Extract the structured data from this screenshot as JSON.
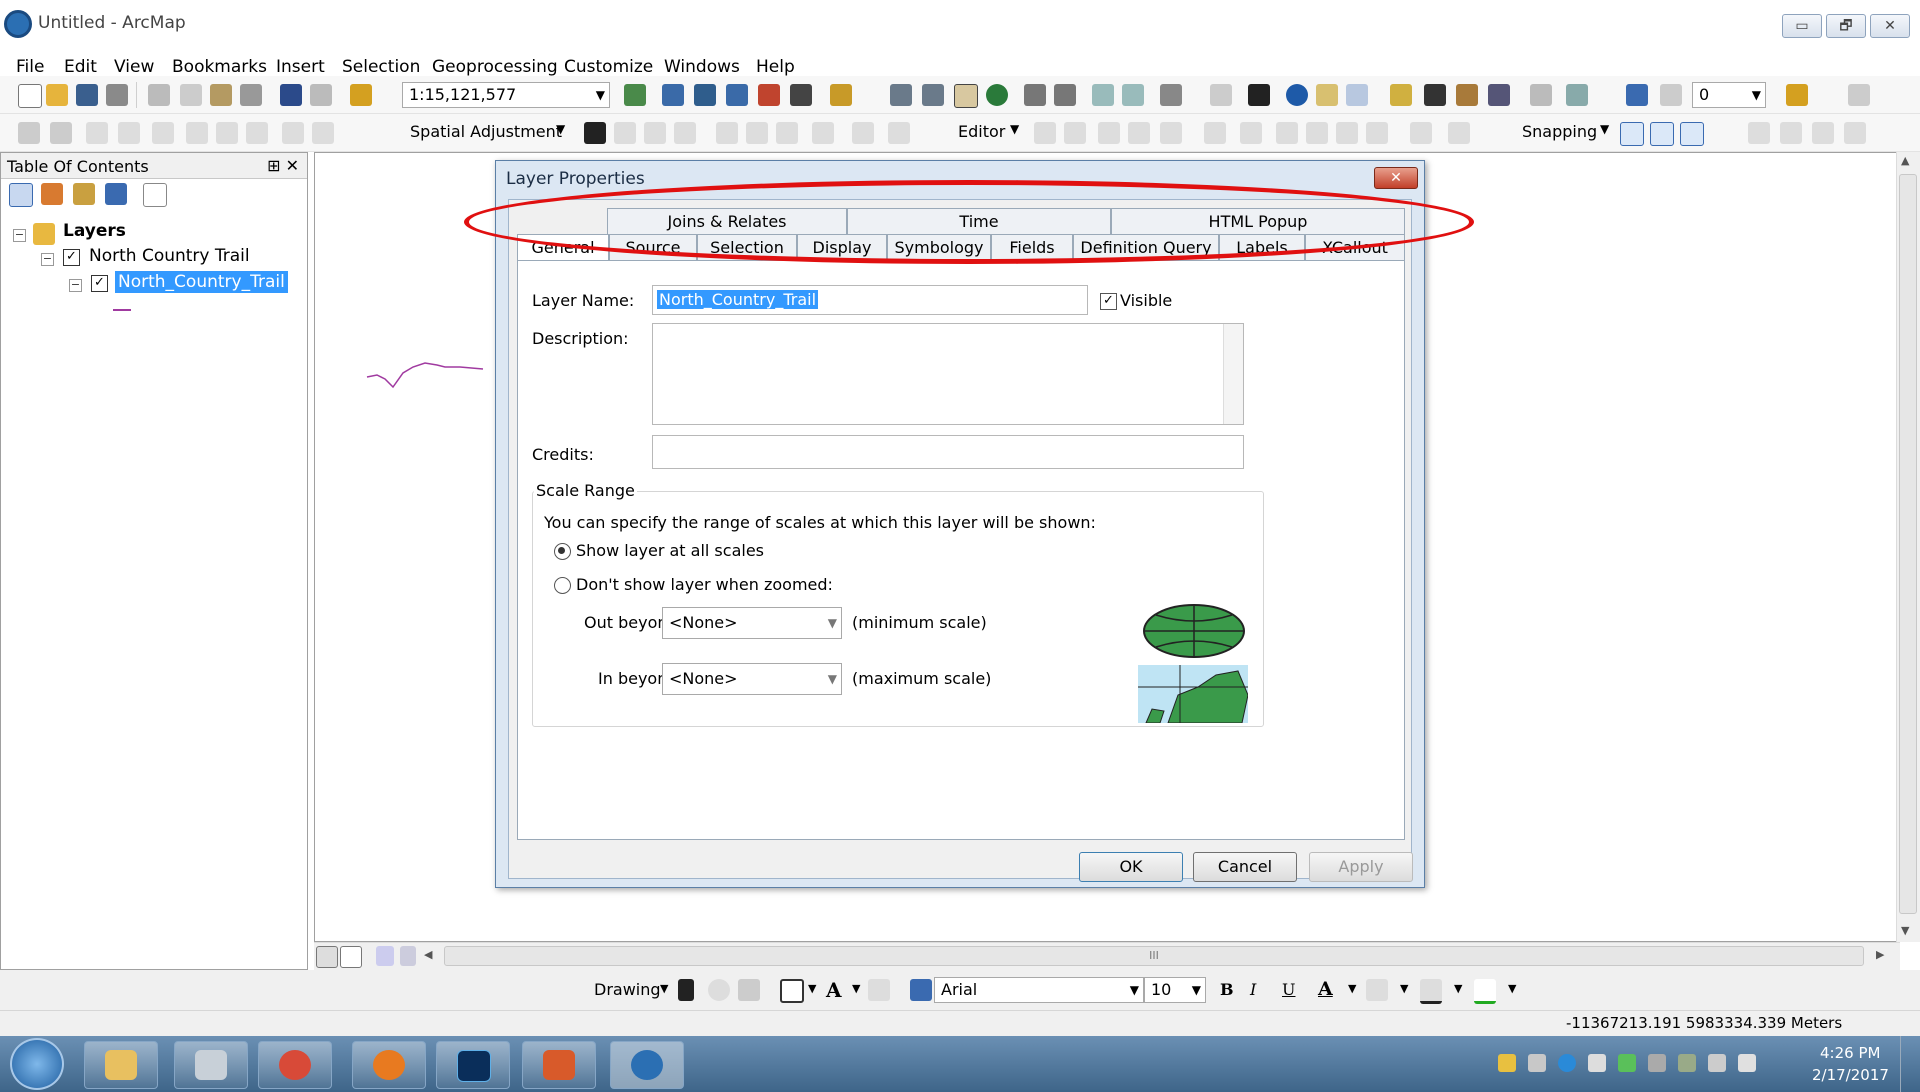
{
  "window": {
    "title": "Untitled - ArcMap",
    "buttons": [
      "▭",
      "🗗",
      "✕"
    ]
  },
  "menu": [
    "File",
    "Edit",
    "View",
    "Bookmarks",
    "Insert",
    "Selection",
    "Geoprocessing",
    "Customize",
    "Windows",
    "Help"
  ],
  "toolbar1": {
    "scale": "1:15,121,577",
    "layer_combo": "0"
  },
  "toolbar2": {
    "spatial_adjustment": "Spatial Adjustment",
    "editor": "Editor",
    "snapping": "Snapping"
  },
  "toc": {
    "title": "Table Of Contents",
    "pin": "⊞ ✕",
    "root": "Layers",
    "group": "North Country Trail",
    "layer": "North_Country_Trail"
  },
  "dialog": {
    "title": "Layer Properties",
    "close": "✕",
    "tabs_row1": [
      "Joins & Relates",
      "Time",
      "HTML Popup"
    ],
    "tabs_row2": [
      "General",
      "Source",
      "Selection",
      "Display",
      "Symbology",
      "Fields",
      "Definition Query",
      "Labels",
      "XCallout"
    ],
    "layer_name_label": "Layer Name:",
    "layer_name_value": "North_Country_Trail",
    "visible_label": "Visible",
    "description_label": "Description:",
    "credits_label": "Credits:",
    "scale_range_label": "Scale Range",
    "scale_text": "You can specify the range of scales at which this layer will be shown:",
    "radio_all": "Show layer at all scales",
    "radio_zoomed": "Don't show layer when zoomed:",
    "out_beyond_label": "Out beyond:",
    "out_beyond_value": "<None>",
    "min_scale": "(minimum scale)",
    "in_beyond_label": "In beyond:",
    "in_beyond_value": "<None>",
    "max_scale": "(maximum scale)",
    "ok": "OK",
    "cancel": "Cancel",
    "apply": "Apply"
  },
  "drawing": {
    "label": "Drawing",
    "font": "Arial",
    "size": "10",
    "bold": "B",
    "italic": "I",
    "underline": "U",
    "font_color": "A"
  },
  "status": {
    "coords": "-11367213.191  5983334.339 Meters"
  },
  "taskbar": {
    "time": "4:26 PM",
    "date": "2/17/2017"
  },
  "hscroll_mark": "III",
  "annotation_color": "#e01010"
}
